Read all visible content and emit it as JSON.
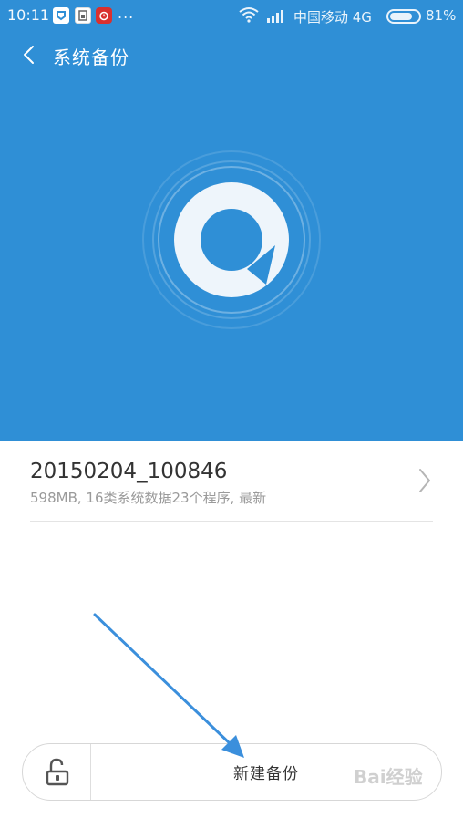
{
  "status_bar": {
    "time": "10:11",
    "more_indicator": "...",
    "carrier": "中国移动 4G",
    "battery_percent": "81%",
    "battery_level": 0.81,
    "notification_icons": [
      "app-notification-icon",
      "sim-icon",
      "alarm-icon"
    ]
  },
  "header": {
    "title": "系统备份",
    "back_icon": "chevron-left-icon"
  },
  "hero": {
    "background_color": "#2f8fd6",
    "logo_icon": "backup-logo-icon"
  },
  "backup_list": [
    {
      "name": "20150204_100846",
      "description": "598MB, 16类系统数据23个程序, 最新"
    }
  ],
  "bottom_bar": {
    "lock_icon": "unlock-icon",
    "new_backup_label": "新建备份"
  },
  "watermark": {
    "text": "Bai经验"
  },
  "colors": {
    "accent": "#2f8fd6",
    "annotation_arrow": "#3b8fdc"
  }
}
